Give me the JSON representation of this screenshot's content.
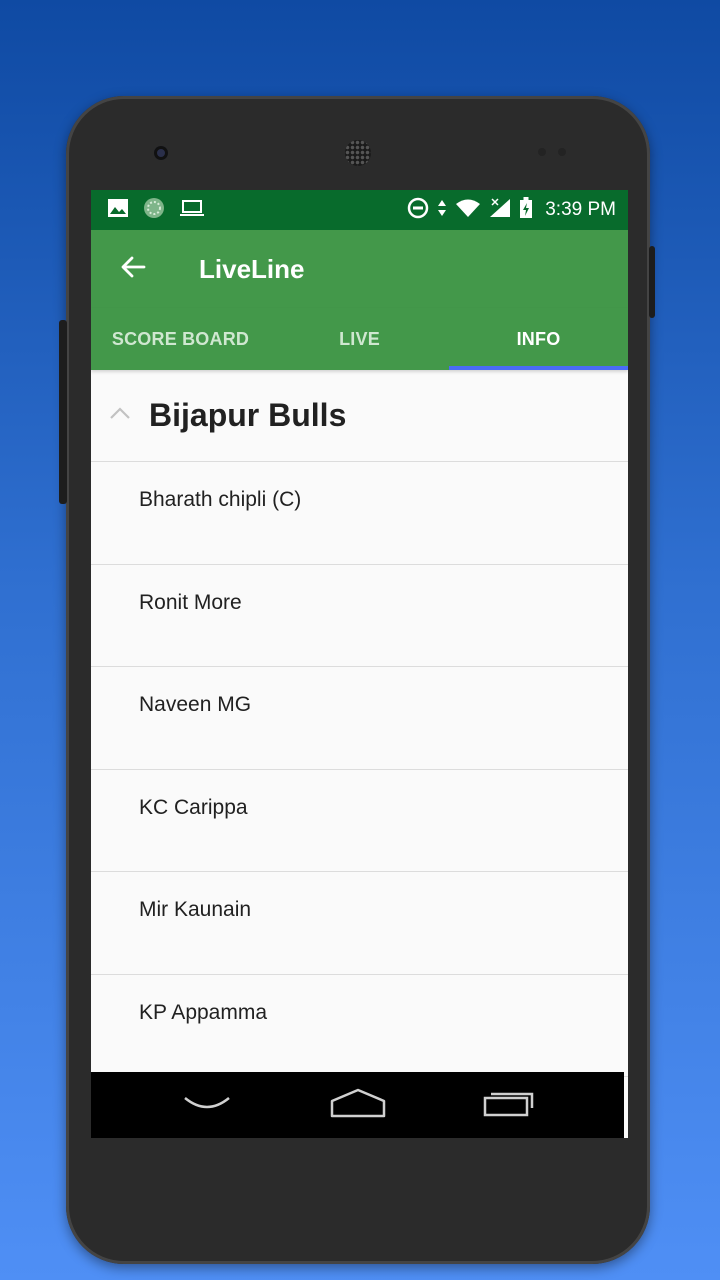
{
  "status_bar": {
    "time": "3:39 PM",
    "left_icons": [
      "image-icon",
      "app-icon",
      "laptop-icon"
    ],
    "right_icons": [
      "data-saver-icon",
      "data-arrows-icon",
      "wifi-icon",
      "signal-icon",
      "battery-charging-icon"
    ]
  },
  "toolbar": {
    "title": "LiveLine"
  },
  "tabs": [
    {
      "label": "SCORE BOARD",
      "active": false
    },
    {
      "label": "LIVE",
      "active": false
    },
    {
      "label": "INFO",
      "active": true
    }
  ],
  "team": {
    "name": "Bijapur Bulls",
    "expanded": true,
    "players": [
      {
        "name": "Bharath chipli (C)"
      },
      {
        "name": "Ronit More"
      },
      {
        "name": "Naveen MG"
      },
      {
        "name": "KC Carippa"
      },
      {
        "name": "Mir Kaunain"
      },
      {
        "name": "KP Appamma"
      }
    ]
  },
  "colors": {
    "status_bar": "#086b2c",
    "toolbar": "#43984a",
    "tab_indicator": "#4a6cf6",
    "background_top": "#0f4aa3",
    "background_bottom": "#4f8ff5"
  }
}
